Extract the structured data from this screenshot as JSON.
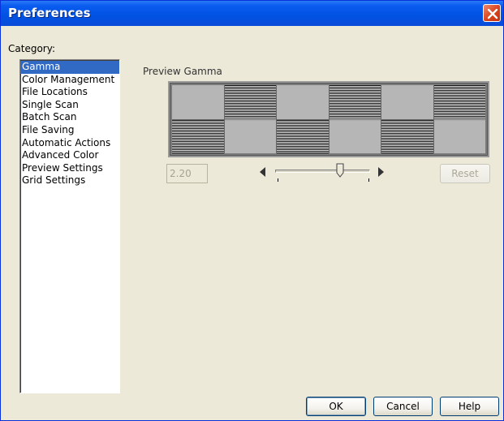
{
  "window": {
    "title": "Preferences"
  },
  "category": {
    "label": "Category:",
    "items": [
      {
        "label": "Gamma",
        "selected": true
      },
      {
        "label": "Color Management",
        "selected": false
      },
      {
        "label": "File Locations",
        "selected": false
      },
      {
        "label": "Single Scan",
        "selected": false
      },
      {
        "label": "Batch Scan",
        "selected": false
      },
      {
        "label": "File Saving",
        "selected": false
      },
      {
        "label": "Automatic Actions",
        "selected": false
      },
      {
        "label": "Advanced Color",
        "selected": false
      },
      {
        "label": "Preview Settings",
        "selected": false
      },
      {
        "label": "Grid Settings",
        "selected": false
      }
    ]
  },
  "gamma": {
    "preview_label": "Preview Gamma",
    "value": "2.20",
    "slider_level": 0.68,
    "reset_label": "Reset"
  },
  "buttons": {
    "ok": "OK",
    "cancel": "Cancel",
    "help": "Help"
  },
  "icons": {
    "close": "close-icon",
    "slider_left": "arrow-left-icon",
    "slider_right": "arrow-right-icon",
    "slider_thumb": "slider-thumb-icon"
  },
  "colors": {
    "titlebar": "#0a5cf0",
    "close": "#d8421c",
    "selection": "#316ac5",
    "dialog_bg": "#ece9d8"
  }
}
